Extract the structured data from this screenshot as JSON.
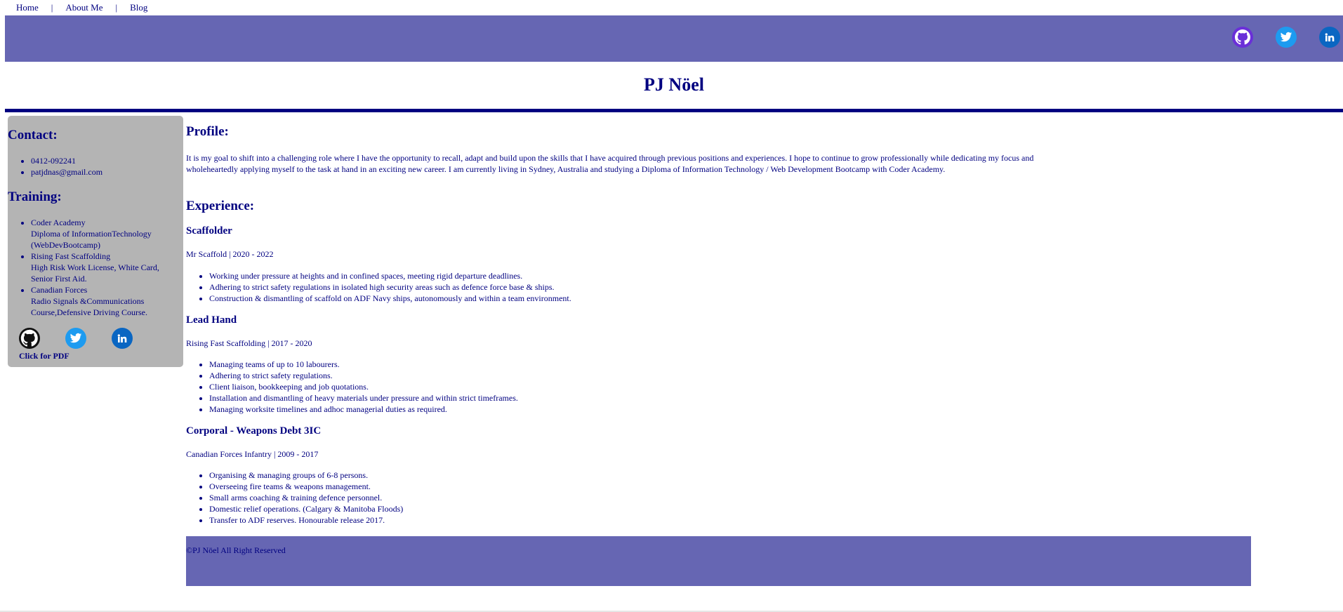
{
  "nav": {
    "items": [
      {
        "label": "Home"
      },
      {
        "label": "About Me"
      },
      {
        "label": "Blog"
      }
    ],
    "separator": "|"
  },
  "header": {
    "social": [
      "github-icon",
      "twitter-icon",
      "linkedin-icon"
    ],
    "banner_color": "#6666b3"
  },
  "title": "PJ Nöel",
  "sidebar": {
    "contact_heading": "Contact:",
    "contact": [
      "0412-092241",
      "patjdnas@gmail.com"
    ],
    "training_heading": "Training:",
    "training": [
      {
        "org": "Coder Academy",
        "detail": "Diploma of InformationTechnology (WebDevBootcamp)"
      },
      {
        "org": "Rising Fast Scaffolding",
        "detail": "High Risk Work License, White Card, Senior First Aid."
      },
      {
        "org": "Canadian Forces",
        "detail": "Radio Signals &Communications Course,Defensive Driving Course."
      }
    ],
    "pdf_link": "Click for PDF",
    "background": "#b4b4b4"
  },
  "main": {
    "profile_heading": "Profile:",
    "profile_text": "It is my goal to shift into a challenging role where I have the opportunity to recall, adapt and build upon the skills that I have acquired through previous positions and experiences. I hope to continue to grow professionally while dedicating my focus and wholeheartedly applying myself to the task at hand in an exciting new career. I am currently living in Sydney, Australia and studying a Diploma of Information Technology / Web Development Bootcamp with Coder Academy.",
    "experience_heading": "Experience:",
    "jobs": [
      {
        "title": "Scaffolder",
        "meta": "Mr Scaffold | 2020 - 2022",
        "duties": [
          "Working under pressure at heights and in confined spaces, meeting rigid departure deadlines.",
          "Adhering to strict safety regulations in isolated high security areas such as defence force base & ships.",
          "Construction & dismantling of scaffold on ADF Navy ships, autonomously and within a team environment."
        ]
      },
      {
        "title": "Lead Hand",
        "meta": "Rising Fast Scaffolding | 2017 - 2020",
        "duties": [
          "Managing teams of up to 10 labourers.",
          "Adhering to strict safety regulations.",
          "Client liaison, bookkeeping and job quotations.",
          "Installation and dismantling of heavy materials under pressure and within strict timeframes.",
          "Managing worksite timelines and adhoc managerial duties as required."
        ]
      },
      {
        "title": "Corporal - Weapons Debt 3IC",
        "meta": "Canadian Forces Infantry | 2009 - 2017",
        "duties": [
          "Organising & managing groups of 6-8 persons.",
          "Overseeing fire teams & weapons management.",
          "Small arms coaching & training defence personnel.",
          "Domestic relief operations. (Calgary & Manitoba Floods)",
          "Transfer to ADF reserves. Honourable release 2017."
        ]
      }
    ]
  },
  "footer": {
    "text": "©PJ Nöel All Right Reserved"
  },
  "colors": {
    "text": "#000080",
    "banner": "#6666b3",
    "rule": "#000080"
  }
}
